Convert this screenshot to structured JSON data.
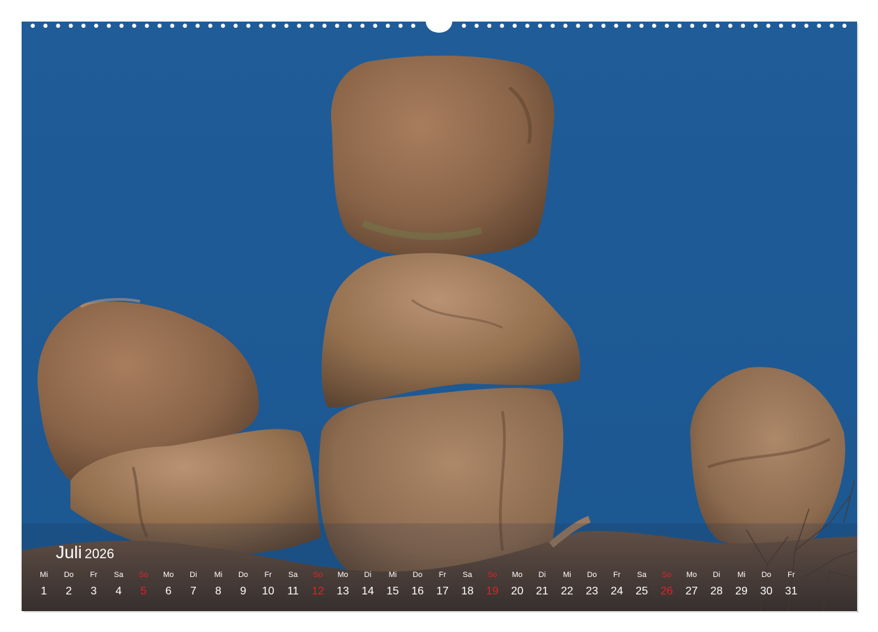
{
  "calendar": {
    "month": "Juli",
    "year": "2026",
    "days": [
      {
        "wd": "Mi",
        "d": "1",
        "sun": false
      },
      {
        "wd": "Do",
        "d": "2",
        "sun": false
      },
      {
        "wd": "Fr",
        "d": "3",
        "sun": false
      },
      {
        "wd": "Sa",
        "d": "4",
        "sun": false
      },
      {
        "wd": "So",
        "d": "5",
        "sun": true
      },
      {
        "wd": "Mo",
        "d": "6",
        "sun": false
      },
      {
        "wd": "Di",
        "d": "7",
        "sun": false
      },
      {
        "wd": "Mi",
        "d": "8",
        "sun": false
      },
      {
        "wd": "Do",
        "d": "9",
        "sun": false
      },
      {
        "wd": "Fr",
        "d": "10",
        "sun": false
      },
      {
        "wd": "Sa",
        "d": "11",
        "sun": false
      },
      {
        "wd": "So",
        "d": "12",
        "sun": true
      },
      {
        "wd": "Mo",
        "d": "13",
        "sun": false
      },
      {
        "wd": "Di",
        "d": "14",
        "sun": false
      },
      {
        "wd": "Mi",
        "d": "15",
        "sun": false
      },
      {
        "wd": "Do",
        "d": "16",
        "sun": false
      },
      {
        "wd": "Fr",
        "d": "17",
        "sun": false
      },
      {
        "wd": "Sa",
        "d": "18",
        "sun": false
      },
      {
        "wd": "So",
        "d": "19",
        "sun": true
      },
      {
        "wd": "Mo",
        "d": "20",
        "sun": false
      },
      {
        "wd": "Di",
        "d": "21",
        "sun": false
      },
      {
        "wd": "Mi",
        "d": "22",
        "sun": false
      },
      {
        "wd": "Do",
        "d": "23",
        "sun": false
      },
      {
        "wd": "Fr",
        "d": "24",
        "sun": false
      },
      {
        "wd": "Sa",
        "d": "25",
        "sun": false
      },
      {
        "wd": "So",
        "d": "26",
        "sun": true
      },
      {
        "wd": "Mo",
        "d": "27",
        "sun": false
      },
      {
        "wd": "Di",
        "d": "28",
        "sun": false
      },
      {
        "wd": "Mi",
        "d": "29",
        "sun": false
      },
      {
        "wd": "Do",
        "d": "30",
        "sun": false
      },
      {
        "wd": "Fr",
        "d": "31",
        "sun": false
      }
    ]
  },
  "colors": {
    "sky": "#1d5a96",
    "rock": "#8a6448",
    "sunday": "#e0222a",
    "text": "#ffffff"
  }
}
